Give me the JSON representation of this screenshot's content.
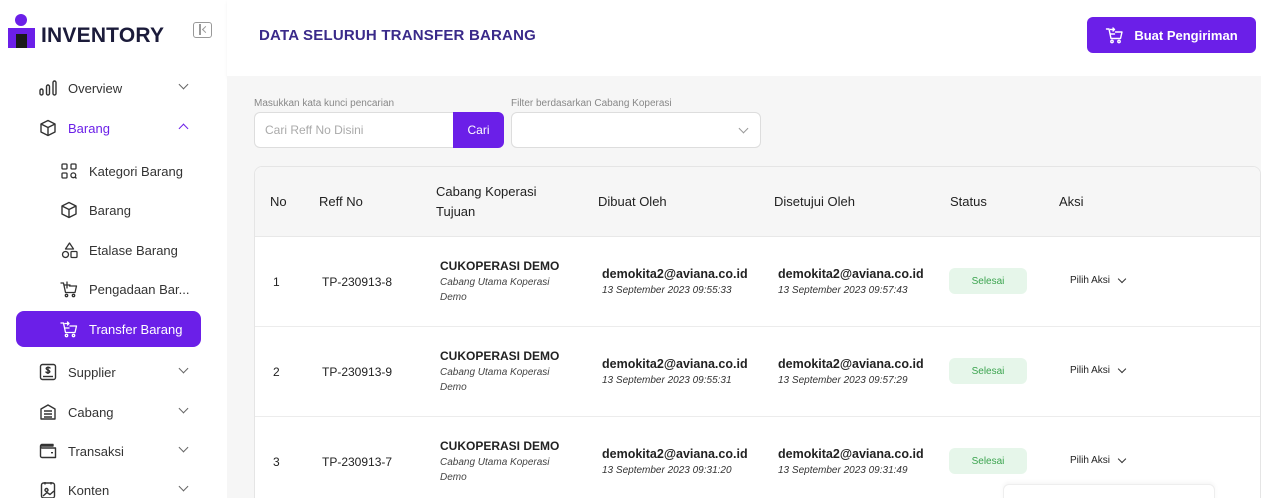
{
  "brand": {
    "name": "INVENTORY"
  },
  "sidebar": {
    "items": [
      {
        "label": "Overview"
      },
      {
        "label": "Barang"
      },
      {
        "label": "Kategori Barang"
      },
      {
        "label": "Barang"
      },
      {
        "label": "Etalase Barang"
      },
      {
        "label": "Pengadaan Bar..."
      },
      {
        "label": "Transfer Barang"
      },
      {
        "label": "Supplier"
      },
      {
        "label": "Cabang"
      },
      {
        "label": "Transaksi"
      },
      {
        "label": "Konten"
      }
    ]
  },
  "header": {
    "title": "DATA SELURUH TRANSFER BARANG",
    "primary_button": "Buat Pengiriman"
  },
  "search": {
    "label": "Masukkan kata kunci pencarian",
    "placeholder": "Cari Reff No Disini",
    "button": "Cari"
  },
  "filter": {
    "label": "Filter berdasarkan Cabang Koperasi",
    "value": ""
  },
  "table": {
    "headers": {
      "no": "No",
      "reff": "Reff No",
      "cabang_1": "Cabang Koperasi",
      "cabang_2": "Tujuan",
      "dibuat": "Dibuat Oleh",
      "disetujui": "Disetujui Oleh",
      "status": "Status",
      "aksi": "Aksi"
    },
    "rows": [
      {
        "no": "1",
        "reff": "TP-230913-8",
        "cabang": "CUKOPERASI DEMO",
        "cabang_sub": "Cabang Utama Koperasi Demo",
        "dibuat_email": "demokita2@aviana.co.id",
        "dibuat_ts": "13 September 2023 09:55:33",
        "disetujui_email": "demokita2@aviana.co.id",
        "disetujui_ts": "13 September 2023 09:57:43",
        "status": "Selesai",
        "aksi": "Pilih Aksi"
      },
      {
        "no": "2",
        "reff": "TP-230913-9",
        "cabang": "CUKOPERASI DEMO",
        "cabang_sub": "Cabang Utama Koperasi Demo",
        "dibuat_email": "demokita2@aviana.co.id",
        "dibuat_ts": "13 September 2023 09:55:31",
        "disetujui_email": "demokita2@aviana.co.id",
        "disetujui_ts": "13 September 2023 09:57:29",
        "status": "Selesai",
        "aksi": "Pilih Aksi"
      },
      {
        "no": "3",
        "reff": "TP-230913-7",
        "cabang": "CUKOPERASI DEMO",
        "cabang_sub": "Cabang Utama Koperasi Demo",
        "dibuat_email": "demokita2@aviana.co.id",
        "dibuat_ts": "13 September 2023 09:31:20",
        "disetujui_email": "demokita2@aviana.co.id",
        "disetujui_ts": "13 September 2023 09:31:49",
        "status": "Selesai",
        "aksi": "Pilih Aksi"
      }
    ]
  },
  "colors": {
    "accent": "#6b1fe8",
    "title": "#3a2a8a",
    "status_bg": "#e6f6ea",
    "status_text": "#3ba44f"
  }
}
